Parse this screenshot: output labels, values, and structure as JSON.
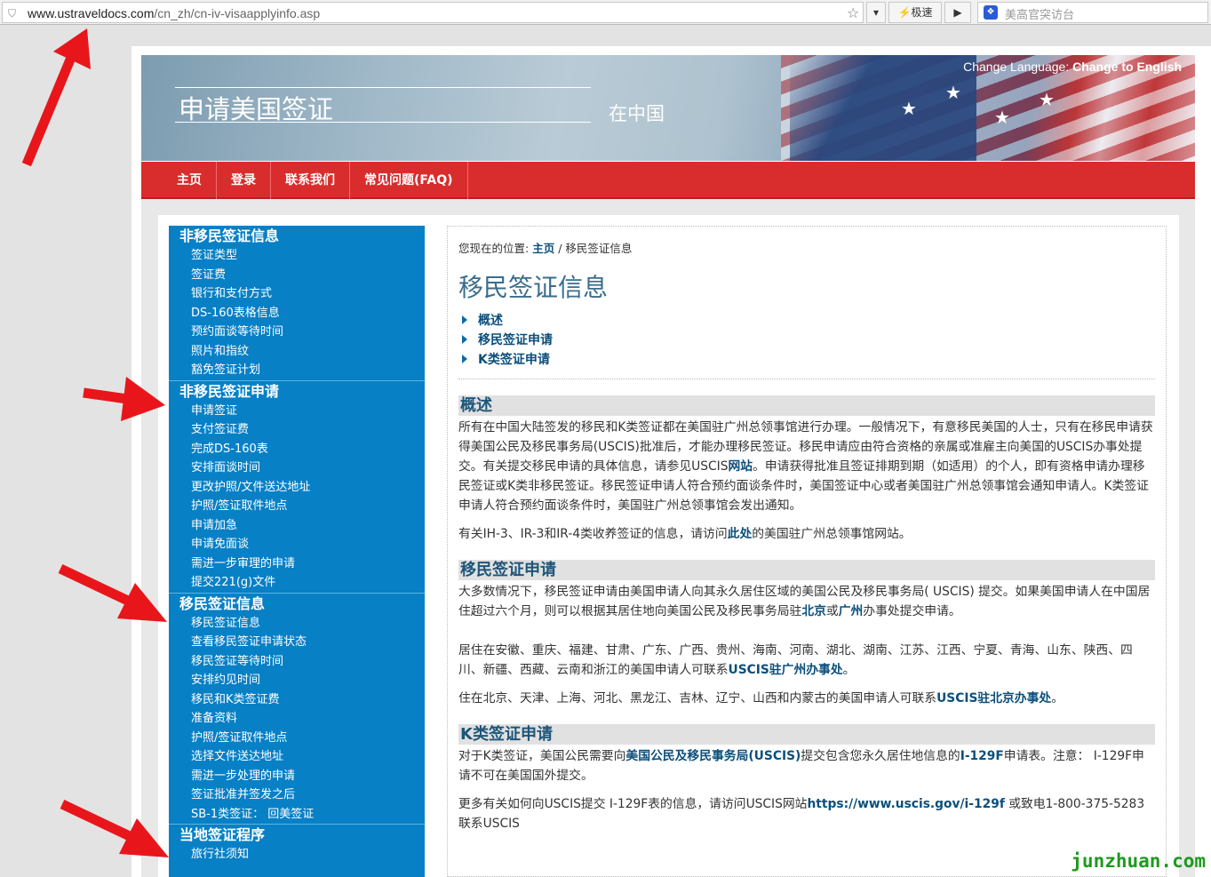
{
  "browser": {
    "url_host": "www.ustraveldocs.com",
    "url_path": "/cn_zh/cn-iv-visaapplyinfo.asp",
    "speed_label": "极速",
    "search_placeholder": "美高官突访台"
  },
  "banner": {
    "title": "申请美国签证",
    "subtitle": "在中国",
    "lang_prefix": "Change Language:",
    "lang_link": "Change to English"
  },
  "nav": {
    "items": [
      "主页",
      "登录",
      "联系我们",
      "常见问题(FAQ)"
    ]
  },
  "sidebar": {
    "sections": [
      {
        "title": "非移民签证信息",
        "items": [
          "签证类型",
          "签证费",
          "银行和支付方式",
          "DS-160表格信息",
          "预约面谈等待时间",
          "照片和指纹",
          "豁免签证计划"
        ]
      },
      {
        "title": "非移民签证申请",
        "items": [
          "申请签证",
          "支付签证费",
          "完成DS-160表",
          "安排面谈时间",
          "更改护照/文件送达地址",
          "护照/签证取件地点",
          "申请加急",
          "申请免面谈",
          "需进一步审理的申请",
          "提交221(g)文件"
        ]
      },
      {
        "title": "移民签证信息",
        "items": [
          "移民签证信息",
          "查看移民签证申请状态",
          "移民签证等待时间",
          "安排约见时间",
          "移民和K类签证费",
          "准备资料",
          "护照/签证取件地点",
          "选择文件送达地址",
          "需进一步处理的申请",
          "签证批准并签发之后",
          "SB-1类签证： 回美签证"
        ]
      },
      {
        "title": "当地签证程序",
        "items": [
          "旅行社须知"
        ]
      }
    ]
  },
  "main": {
    "crumb_prefix": "您现在的位置:",
    "crumb_home": "主页",
    "crumb_sep": "/",
    "crumb_current": "移民签证信息",
    "title": "移民签证信息",
    "toc": [
      "概述",
      "移民签证申请",
      "K类签证申请"
    ],
    "s1": {
      "heading": "概述",
      "p1_a": "所有在中国大陆签发的移民和K类签证都在美国驻广州总领事馆进行办理。一般情况下，有意移民美国的人士，只有在移民申请获得美国公民及移民事务局(USCIS)批准后，才能办理移民签证。移民申请应由符合资格的亲属或准雇主向美国的USCIS办事处提交。有关提交移民申请的具体信息，请参见USCIS",
      "p1_link": "网站",
      "p1_b": "。申请获得批准且签证排期到期（如适用）的个人，即有资格申请办理移民签证或K类非移民签证。移民签证申请人符合预约面谈条件时，美国签证中心或者美国驻广州总领事馆会通知申请人。K类签证申请人符合预约面谈条件时，美国驻广州总领事馆会发出通知。",
      "p2_a": "有关IH-3、IR-3和IR-4类收养签证的信息，请访问",
      "p2_link": "此处",
      "p2_b": "的美国驻广州总领事馆网站。"
    },
    "s2": {
      "heading": "移民签证申请",
      "p1_a": "大多数情况下，移民签证申请由美国申请人向其永久居住区域的美国公民及移民事务局( USCIS) 提交。如果美国申请人在中国居住超过六个月，则可以根据其居住地向美国公民及移民事务局驻",
      "p1_link1": "北京",
      "p1_mid": "或",
      "p1_link2": "广州",
      "p1_b": "办事处提交申请。",
      "p2_a": "居住在安徽、重庆、福建、甘肃、广东、广西、贵州、海南、河南、湖北、湖南、江苏、江西、宁夏、青海、山东、陕西、四川、新疆、西藏、云南和浙江的美国申请人可联系",
      "p2_link": "USCIS驻广州办事处",
      "p2_b": "。",
      "p3_a": "住在北京、天津、上海、河北、黑龙江、吉林、辽宁、山西和内蒙古的美国申请人可联系",
      "p3_link": "USCIS驻北京办事处",
      "p3_b": "。"
    },
    "s3": {
      "heading": "K类签证申请",
      "p1_a": "对于K类签证，美国公民需要向",
      "p1_link1": "美国公民及移民事务局(USCIS)",
      "p1_mid": "提交包含您永久居住地信息的",
      "p1_link2": "I-129F",
      "p1_b": "申请表。注意： I-129F申请不可在美国国外提交。",
      "p2_a": "更多有关如何向USCIS提交 I-129F表的信息，请访问USCIS网站",
      "p2_link": "https://www.uscis.gov/i-129f",
      "p2_b": " 或致电1-800-375-5283联系USCIS"
    }
  },
  "watermark": "junzhuan.com",
  "colors": {
    "nav_red": "#d92d2d",
    "sidebar_blue": "#0780c6",
    "arrow_red": "#e8161b",
    "link": "#0b4f7c"
  }
}
